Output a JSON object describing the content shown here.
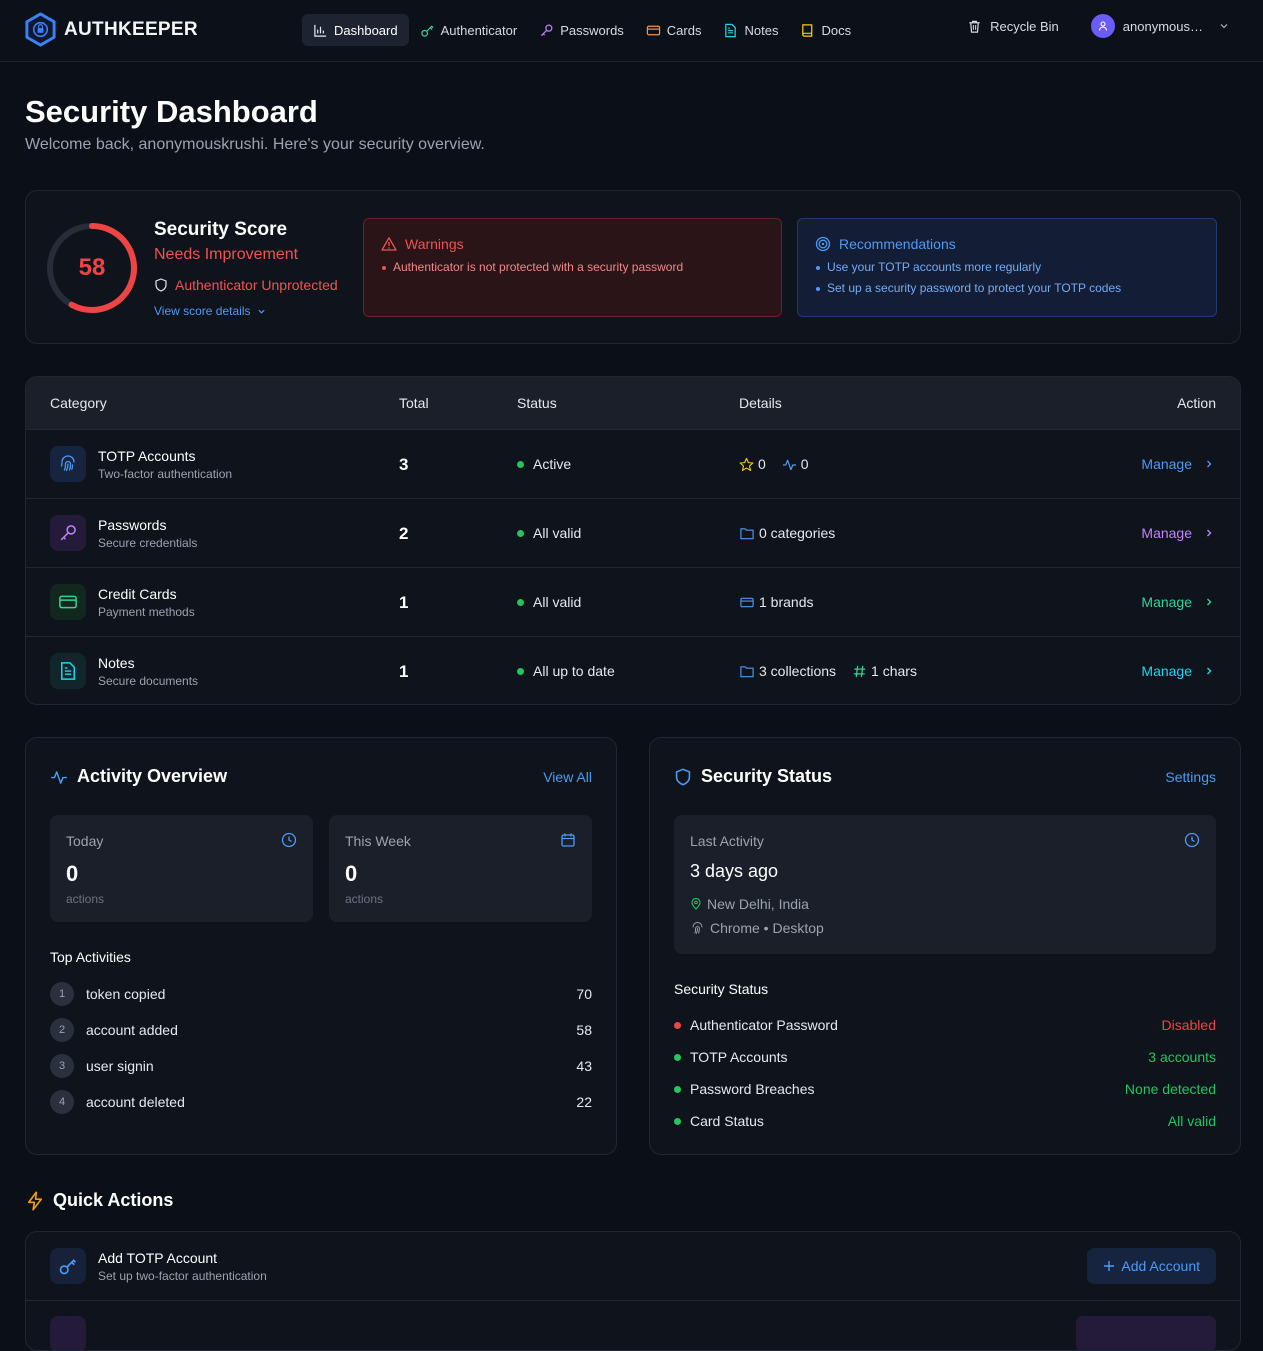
{
  "brand": {
    "name": "AUTHKEEPER"
  },
  "nav": {
    "items": [
      {
        "label": "Dashboard",
        "icon": "bar-chart-icon",
        "active": true
      },
      {
        "label": "Authenticator",
        "icon": "key-icon"
      },
      {
        "label": "Passwords",
        "icon": "key-alt-icon"
      },
      {
        "label": "Cards",
        "icon": "credit-card-icon"
      },
      {
        "label": "Notes",
        "icon": "file-text-icon"
      },
      {
        "label": "Docs",
        "icon": "book-icon"
      }
    ],
    "recycle_bin": "Recycle Bin",
    "user": "anonymous…"
  },
  "header": {
    "title": "Security Dashboard",
    "subtitle": "Welcome back, anonymouskrushi. Here's your security overview."
  },
  "score": {
    "value": "58",
    "fraction": 0.58,
    "title": "Security Score",
    "state": "Needs Improvement",
    "auth_status": "Authenticator Unprotected",
    "details_link": "View score details",
    "color": "#ef4444"
  },
  "warnings": {
    "title": "Warnings",
    "items": [
      "Authenticator is not protected with a security password"
    ]
  },
  "recommendations": {
    "title": "Recommendations",
    "items": [
      "Use your TOTP accounts more regularly",
      "Set up a security password to protect your TOTP codes"
    ]
  },
  "table": {
    "headers": {
      "category": "Category",
      "total": "Total",
      "status": "Status",
      "details": "Details",
      "action": "Action"
    },
    "rows": [
      {
        "name": "TOTP Accounts",
        "desc": "Two-factor authentication",
        "total": "3",
        "status": "Active",
        "details": [
          {
            "icon": "star-icon",
            "text": "0"
          },
          {
            "icon": "activity-icon",
            "text": "0"
          }
        ],
        "action": "Manage",
        "color": "#4d9bf5",
        "bg": "#172440"
      },
      {
        "name": "Passwords",
        "desc": "Secure credentials",
        "total": "2",
        "status": "All valid",
        "details": [
          {
            "icon": "folder-icon",
            "text": "0 categories"
          }
        ],
        "action": "Manage",
        "color": "#c084fc",
        "bg": "#241a3a"
      },
      {
        "name": "Credit Cards",
        "desc": "Payment methods",
        "total": "1",
        "status": "All valid",
        "details": [
          {
            "icon": "credit-card-icon",
            "text": "1 brands"
          }
        ],
        "action": "Manage",
        "color": "#34d399",
        "bg": "#12281f"
      },
      {
        "name": "Notes",
        "desc": "Secure documents",
        "total": "1",
        "status": "All up to date",
        "details": [
          {
            "icon": "folder-icon",
            "text": "3 collections"
          },
          {
            "icon": "hash-icon",
            "text": "1 chars"
          }
        ],
        "action": "Manage",
        "color": "#22d3ee",
        "bg": "#10262b"
      }
    ]
  },
  "activity": {
    "title": "Activity Overview",
    "view_all": "View All",
    "today": {
      "label": "Today",
      "value": "0",
      "unit": "actions"
    },
    "week": {
      "label": "This Week",
      "value": "0",
      "unit": "actions"
    },
    "top_title": "Top Activities",
    "top": [
      {
        "rank": "1",
        "label": "token copied",
        "count": "70"
      },
      {
        "rank": "2",
        "label": "account added",
        "count": "58"
      },
      {
        "rank": "3",
        "label": "user signin",
        "count": "43"
      },
      {
        "rank": "4",
        "label": "account deleted",
        "count": "22"
      }
    ]
  },
  "security": {
    "title": "Security Status",
    "settings": "Settings",
    "last_activity": {
      "label": "Last Activity",
      "value": "3 days ago",
      "location": "New Delhi, India",
      "device": "Chrome • Desktop"
    },
    "status_title": "Security Status",
    "items": [
      {
        "label": "Authenticator Password",
        "value": "Disabled",
        "color": "#ef4444"
      },
      {
        "label": "TOTP Accounts",
        "value": "3 accounts",
        "color": "#22c55e"
      },
      {
        "label": "Password Breaches",
        "value": "None detected",
        "color": "#22c55e"
      },
      {
        "label": "Card Status",
        "value": "All valid",
        "color": "#22c55e"
      }
    ]
  },
  "quick_actions": {
    "title": "Quick Actions",
    "items": [
      {
        "name": "Add TOTP Account",
        "desc": "Set up two-factor authentication",
        "button": "Add Account"
      }
    ]
  }
}
